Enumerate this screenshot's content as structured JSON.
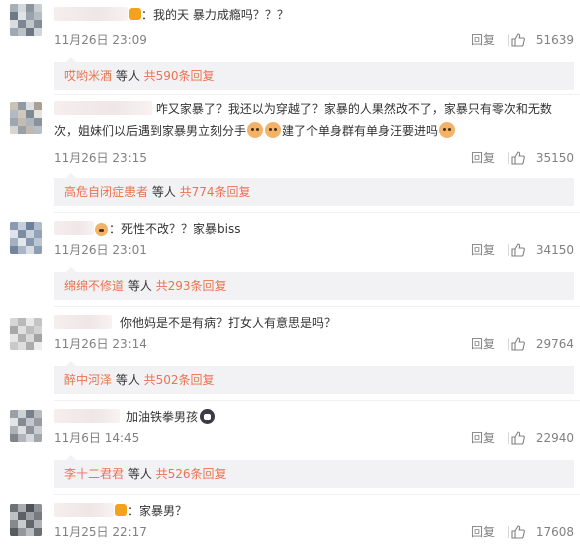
{
  "comments": [
    {
      "text": "：我的天 暴力成瘾吗？？？",
      "time": "11月26日 23:09",
      "reply_label": "回复",
      "likes": "51639",
      "reply_preview": {
        "who": "哎哟米酒",
        "mid": " 等人 ",
        "count": "共590条回复"
      }
    },
    {
      "text_a": "咋又家暴了？我还以为穿越了？家暴的人果然改不了，家暴只有零次和无数次，姐妹们以后遇到家暴男立刻分手",
      "text_b": "建了个单身群有单身汪要进吗",
      "time": "11月26日 23:15",
      "reply_label": "回复",
      "likes": "35150",
      "reply_preview": {
        "who": "高危自闭症患者",
        "mid": " 等人 ",
        "count": "共774条回复"
      }
    },
    {
      "text": "：死性不改？？家暴biss",
      "time": "11月26日 23:01",
      "reply_label": "回复",
      "likes": "34150",
      "reply_preview": {
        "who": "绵绵不修道",
        "mid": " 等人 ",
        "count": "共293条回复"
      }
    },
    {
      "text": "你他妈是不是有病？打女人有意思是吗？",
      "time": "11月26日 23:14",
      "reply_label": "回复",
      "likes": "29764",
      "reply_preview": {
        "who": "醉中河泽",
        "mid": " 等人 ",
        "count": "共502条回复"
      }
    },
    {
      "text": "加油铁拳男孩",
      "time": "11月6日 14:45",
      "reply_label": "回复",
      "likes": "22940",
      "reply_preview": {
        "who": "李十二君君",
        "mid": " 等人 ",
        "count": "共526条回复"
      }
    },
    {
      "text": "：家暴男？",
      "time": "11月25日 22:17",
      "reply_label": "回复",
      "likes": "17608"
    }
  ],
  "colors": {
    "accent": "#eb7350",
    "meta": "#808080",
    "reply_bg": "#f2f2f5"
  },
  "icons": {
    "like": "thumbs-up-icon",
    "badge": "vip-badge-icon",
    "emoji": "cat-emoji-icon"
  }
}
